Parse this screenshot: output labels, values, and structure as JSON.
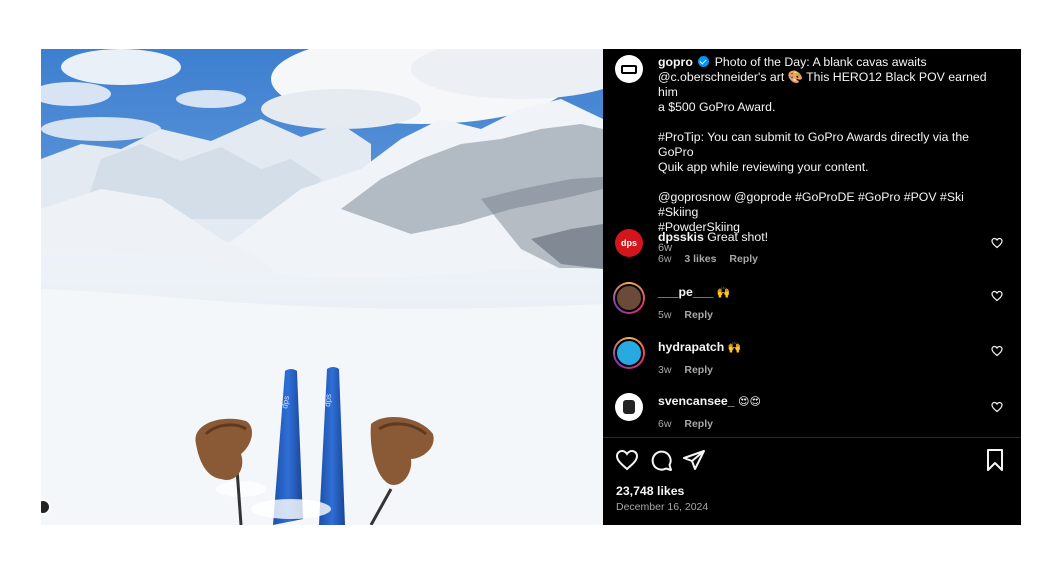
{
  "post": {
    "author": "gopro",
    "caption_lines": [
      "Photo of the Day: A blank cavas awaits",
      "@c.oberschneider's art 🎨 This HERO12 Black POV earned him",
      "a $500 GoPro Award."
    ],
    "protip_lines": [
      "#ProTip: You can submit to GoPro Awards directly via the GoPro",
      "Quik app while reviewing your content."
    ],
    "tags_lines": [
      "@goprosnow @goprode #GoProDE #GoPro #POV #Ski #Skiing",
      "#PowderSkiing"
    ],
    "caption_time": "6w",
    "likes": "23,748 likes",
    "date": "December 16, 2024"
  },
  "comments": [
    {
      "user": "dpsskis",
      "text": "Great shot!",
      "time": "6w",
      "likes": "3 likes",
      "reply": "Reply",
      "avatar_text": "dps"
    },
    {
      "user": "___pe___",
      "text": "🙌",
      "time": "5w",
      "reply": "Reply"
    },
    {
      "user": "hydrapatch",
      "text": "🙌",
      "time": "3w",
      "reply": "Reply"
    },
    {
      "user": "svencansee_",
      "text": "😍😍",
      "time": "6w",
      "reply": "Reply"
    }
  ],
  "icons": {
    "like": "heart-icon",
    "comment": "comment-icon",
    "share": "share-icon",
    "save": "bookmark-icon",
    "comment_like": "heart-small-icon",
    "verified": "verified-badge-icon"
  },
  "colors": {
    "panel_bg": "#000000",
    "text": "#f5f5f5",
    "muted": "#a8a8a8",
    "verified": "#0095f6",
    "dps_red": "#d3161c"
  }
}
